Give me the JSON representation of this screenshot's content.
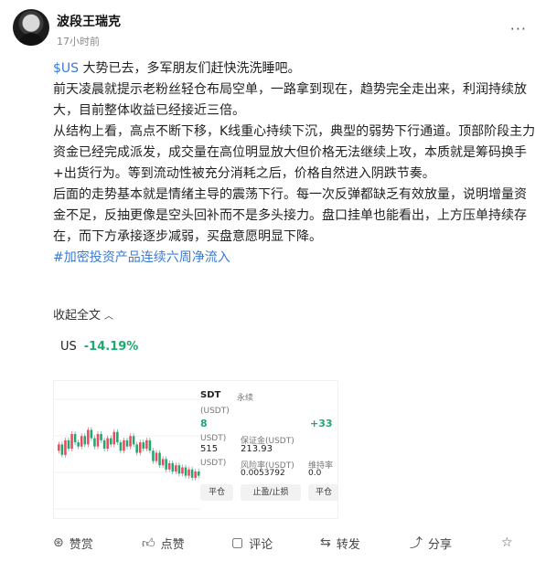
{
  "post": {
    "author": "波段王瑞克",
    "time": "17小时前",
    "more": "···"
  },
  "content": {
    "ticker_link": "$US",
    "line1_rest": " 大势已去，多军朋友们赶快洗洗睡吧。",
    "p2": "前天凌晨就提示老粉丝轻仓布局空单，一路拿到现在，趋势完全走出来，利润持续放大，目前整体收益已经接近三倍。",
    "p3": "从结构上看，高点不断下移，K线重心持续下沉，典型的弱势下行通道。顶部阶段主力资金已经完成派发，成交量在高位明显放大但价格无法继续上攻，本质就是筹码换手+出货行为。等到流动性被充分消耗之后，价格自然进入阴跌节奏。",
    "p4": "后面的走势基本就是情绪主导的震荡下行。每一次反弹都缺乏有效放量，说明增量资金不足，反抽更像是空头回补而不是多头接力。盘口挂单也能看出，上方压单持续存在，而下方承接逐步减弱，买盘意愿明显下降。",
    "hashtag": "#加密投资产品连续六周净流入"
  },
  "collapse_label": "收起全文",
  "ticker": {
    "name": "US",
    "change": "-14.19%"
  },
  "screenshot": {
    "pair": "SDT",
    "tag": "永续",
    "sub1": "(USDT)",
    "green_left": "8",
    "green_right": "+33",
    "label_a": "USDT)",
    "label_b": "保证金(USDT)",
    "val_a": "515",
    "val_b": "213.93",
    "label_c": "USDT)",
    "label_d": "风险率(USDT)",
    "label_e": "维持率",
    "val_d": "0.0053792",
    "val_e": "0.0",
    "btn1": "平仓",
    "btn2": "止盈/止损",
    "btn3": "平仓",
    "colors": {
      "up": "#e84a5f",
      "down": "#20a870"
    },
    "candles": [
      0.42,
      0.45,
      0.4,
      0.47,
      0.43,
      0.5,
      0.46,
      0.44,
      0.49,
      0.45,
      0.52,
      0.48,
      0.44,
      0.5,
      0.47,
      0.43,
      0.48,
      0.45,
      0.51,
      0.46,
      0.42,
      0.47,
      0.44,
      0.49,
      0.45,
      0.41,
      0.46,
      0.43,
      0.47,
      0.42,
      0.37,
      0.41,
      0.35,
      0.38,
      0.33,
      0.36,
      0.32,
      0.35,
      0.31,
      0.34,
      0.3,
      0.33,
      0.29,
      0.32,
      0.3
    ]
  },
  "actions": {
    "like": "赞赏",
    "upvote": "点赞",
    "comment": "评论",
    "repost": "转发",
    "share": "分享"
  }
}
